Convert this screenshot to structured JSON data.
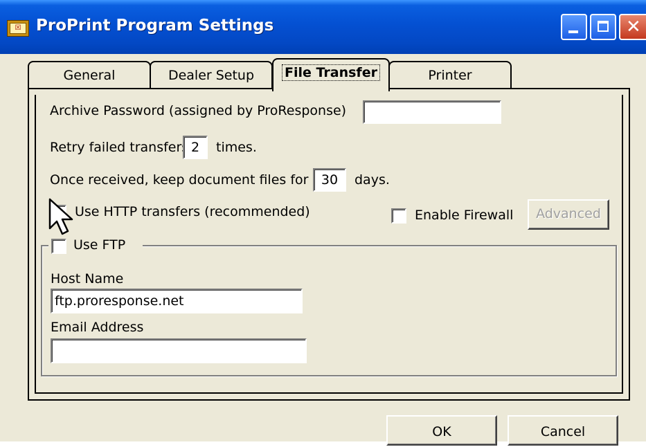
{
  "window": {
    "title": "ProPrint Program Settings",
    "icon": "app-icon",
    "controls": {
      "minimize": "minimize-icon",
      "maximize": "maximize-icon",
      "close": "close-icon"
    }
  },
  "tabs": [
    {
      "label": "General",
      "selected": false
    },
    {
      "label": "Dealer Setup",
      "selected": false
    },
    {
      "label": "File Transfer",
      "selected": true
    },
    {
      "label": "Printer",
      "selected": false
    }
  ],
  "file_transfer": {
    "archive_password_label": "Archive Password (assigned by ProResponse)",
    "archive_password_value": "",
    "retry_label_before": "Retry failed transfers",
    "retry_value": "2",
    "retry_label_after": "times.",
    "keep_label_before": "Once received, keep document files for",
    "keep_value": "30",
    "keep_label_after": "days.",
    "use_http_label": "Use HTTP transfers (recommended)",
    "use_http_checked": true,
    "enable_firewall_label": "Enable Firewall",
    "enable_firewall_checked": false,
    "advanced_label": "Advanced",
    "use_ftp_label": "Use FTP",
    "use_ftp_checked": false,
    "host_name_label": "Host Name",
    "host_name_value": "ftp.proresponse.net",
    "email_label": "Email Address",
    "email_value": ""
  },
  "footer": {
    "ok_label": "OK",
    "cancel_label": "Cancel"
  },
  "colors": {
    "titlebar": "#0450d2",
    "dialog_bg": "#ece9d8",
    "close_button": "#c4391f"
  }
}
